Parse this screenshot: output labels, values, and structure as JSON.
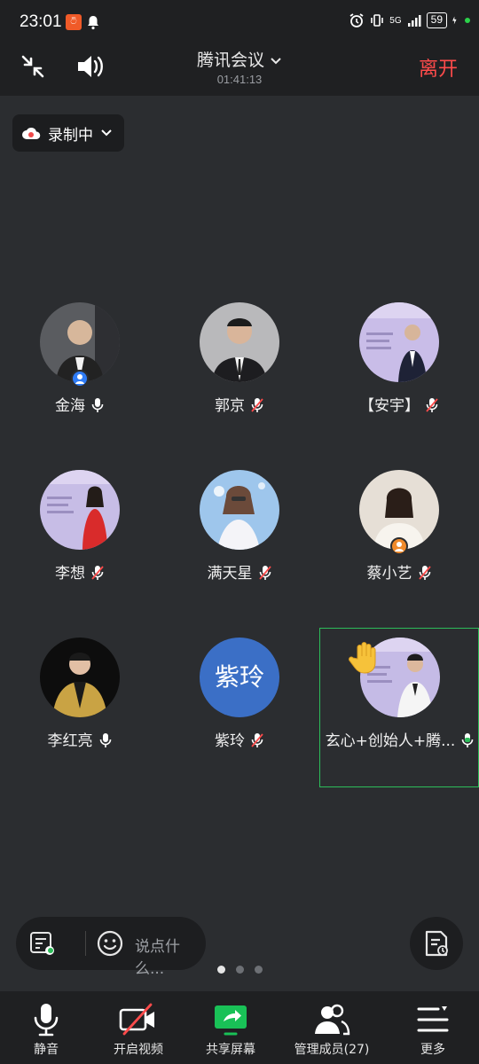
{
  "status": {
    "time": "23:01",
    "app_badge": "ටි",
    "signal": "5G",
    "battery": "59"
  },
  "header": {
    "title": "腾讯会议",
    "timer": "01:41:13",
    "leave_label": "离开"
  },
  "recording": {
    "label": "录制中"
  },
  "participants": [
    {
      "name": "金海",
      "mic": "on",
      "badge": "host"
    },
    {
      "name": "郭京",
      "mic": "muted"
    },
    {
      "name": "【安宇】",
      "mic": "muted"
    },
    {
      "name": "李想",
      "mic": "muted"
    },
    {
      "name": "满天星",
      "mic": "muted"
    },
    {
      "name": "蔡小艺",
      "mic": "muted",
      "badge": "cohost"
    },
    {
      "name": "李红亮",
      "mic": "on"
    },
    {
      "name": "紫玲",
      "initials": "紫玲",
      "mic": "muted"
    },
    {
      "name": "玄心+创始人+腾...",
      "mic": "speaking",
      "hand_raised": true
    }
  ],
  "chat": {
    "placeholder": "说点什么..."
  },
  "pager": {
    "pages": 3,
    "current": 1
  },
  "toolbar": {
    "mute_label": "静音",
    "video_label": "开启视频",
    "share_label": "共享屏幕",
    "members_label": "管理成员(27)",
    "more_label": "更多"
  },
  "colors": {
    "background": "#2b2d30",
    "leave": "#ff4b4b",
    "active_border": "#2dbd5a",
    "share_green": "#19c157",
    "initials_avatar": "#3b6fc6"
  }
}
